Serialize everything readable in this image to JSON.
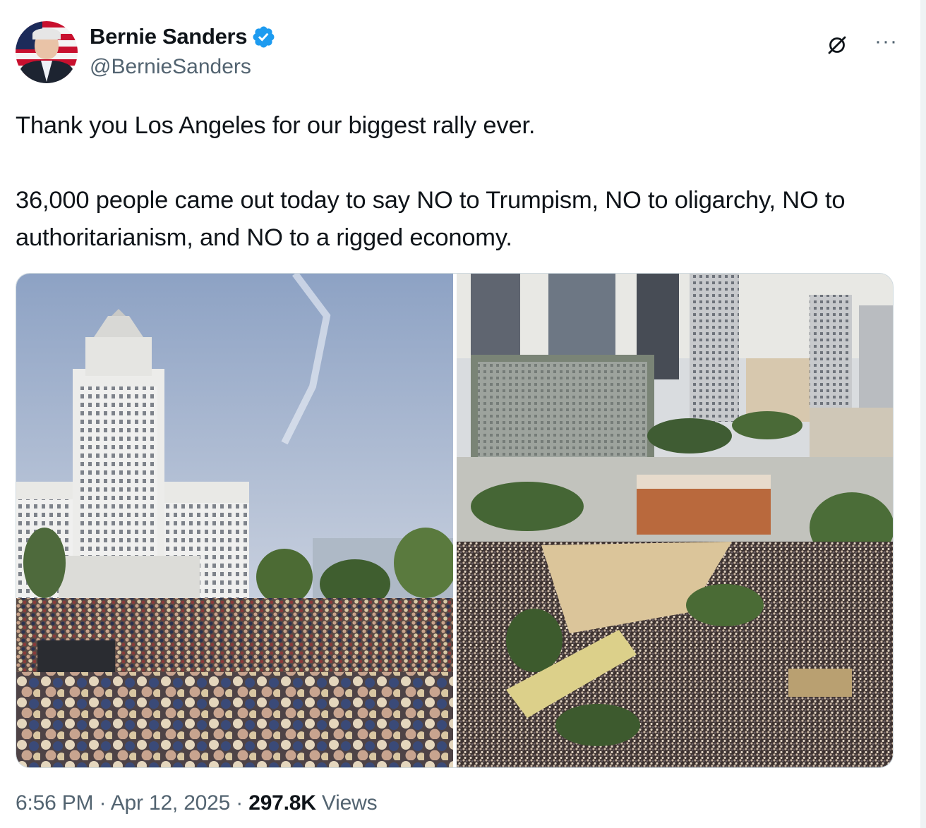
{
  "author": {
    "display_name": "Bernie Sanders",
    "handle": "@BernieSanders",
    "verified": true
  },
  "header_icons": [
    "grok-icon",
    "more-icon"
  ],
  "more_label": "···",
  "tweet": {
    "text": "Thank you Los Angeles for our biggest rally ever.\n\n36,000 people came out today to say NO to Trumpism, NO to oligarchy, NO to authoritarianism, and NO to a rigged economy."
  },
  "media": {
    "photos": [
      {
        "subject": "city-hall-rally-photo"
      },
      {
        "subject": "aerial-crowd-photo"
      }
    ]
  },
  "meta": {
    "time": "6:56 PM",
    "separator": " · ",
    "date": "Apr 12, 2025",
    "views_count": "297.8K",
    "views_label": " Views"
  },
  "colors": {
    "verified_blue": "#1d9bf0",
    "secondary_text": "#536471",
    "primary_text": "#0f1419",
    "border": "#cfd9de"
  }
}
